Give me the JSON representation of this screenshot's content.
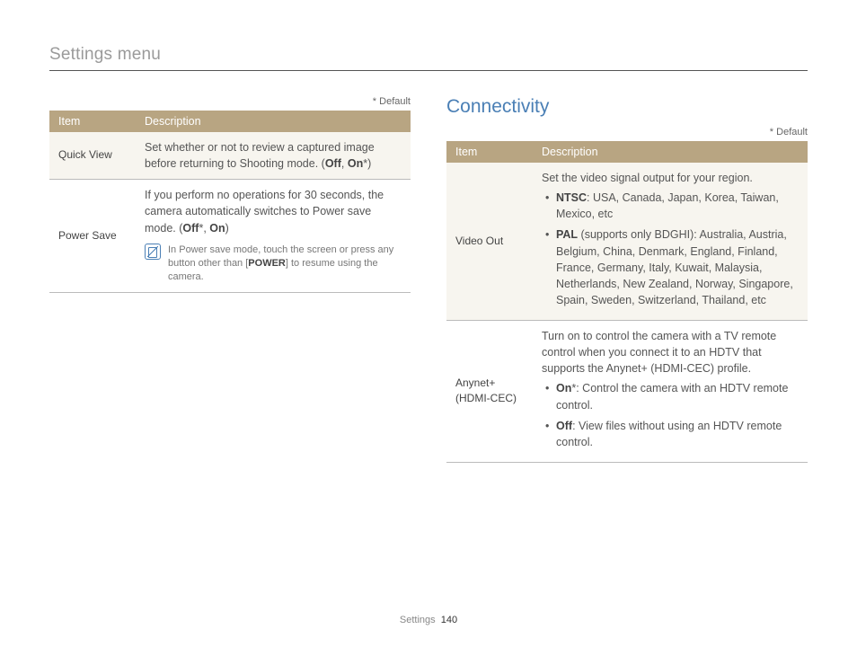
{
  "page": {
    "title": "Settings menu",
    "footer_section": "Settings",
    "footer_page": "140"
  },
  "default_marker": "* Default",
  "headers": {
    "item": "Item",
    "description": "Description"
  },
  "left_table": {
    "rows": [
      {
        "item": "Quick View",
        "desc_pre": "Set whether or not to review a captured image before returning to Shooting mode. (",
        "off": "Off",
        "comma": ", ",
        "on": "On",
        "star": "*",
        "desc_post": ")"
      },
      {
        "item": "Power Save",
        "desc_pre": "If you perform no operations for 30 seconds, the camera automatically switches to Power save mode. (",
        "off": "Off",
        "star1": "*",
        "comma": ", ",
        "on": "On",
        "desc_post": ")",
        "note_pre": "In Power save mode, touch the screen or press any button other than [",
        "note_btn": "POWER",
        "note_post": "] to resume using the camera."
      }
    ]
  },
  "right": {
    "heading": "Connectivity",
    "rows": [
      {
        "item": "Video Out",
        "lead": "Set the video signal output for your region.",
        "opt1_label": "NTSC",
        "opt1_text": ": USA, Canada, Japan, Korea, Taiwan, Mexico, etc",
        "opt2_label": "PAL",
        "opt2_paren": " (supports only BDGHI)",
        "opt2_text": ": Australia, Austria, Belgium, China, Denmark, England, Finland, France, Germany, Italy, Kuwait, Malaysia, Netherlands, New Zealand, Norway, Singapore, Spain, Sweden, Switzerland, Thailand, etc"
      },
      {
        "item": "Anynet+ (HDMI-CEC)",
        "lead": "Turn on to control the camera with a TV remote control when you connect it to an HDTV that supports the Anynet+ (HDMI-CEC) profile.",
        "opt1_label": "On",
        "opt1_star": "*",
        "opt1_text": ": Control the camera with an HDTV remote control.",
        "opt2_label": "Off",
        "opt2_text": ": View files without using an HDTV remote control."
      }
    ]
  }
}
